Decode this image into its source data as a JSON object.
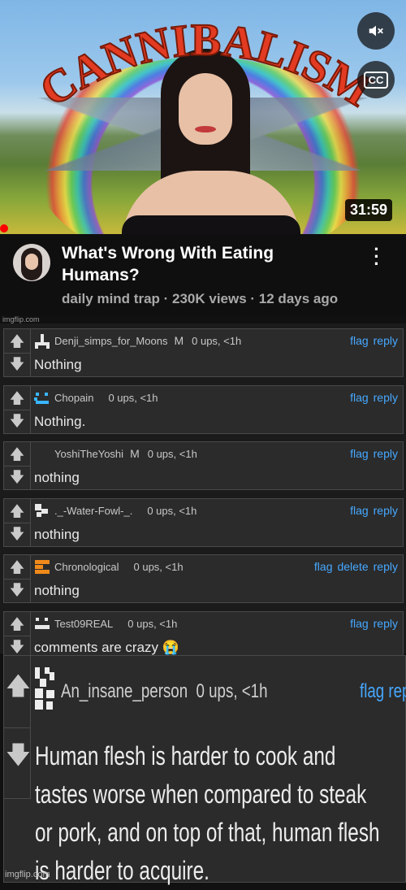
{
  "video": {
    "thumbnail_text": "CANNIBALISM",
    "duration": "31:59",
    "mute_icon": "mute-icon",
    "cc_label": "CC"
  },
  "info": {
    "title": "What's Wrong With Eating Humans?",
    "meta": "daily mind trap · 230K views · 12 days ago",
    "watermark": "imgflip.com"
  },
  "comments": [
    {
      "user": "Denji_simps_for_Moons",
      "mod": "M",
      "meta": "0 ups, <1h",
      "actions": [
        "flag",
        "reply"
      ],
      "text": "Nothing",
      "avatar_color": "#e8e8e8"
    },
    {
      "user": "Chopain",
      "mod": "",
      "meta": "0 ups, <1h",
      "actions": [
        "flag",
        "reply"
      ],
      "text": "Nothing.",
      "avatar_color": "#39b6ff"
    },
    {
      "user": "YoshiTheYoshi",
      "mod": "M",
      "meta": "0 ups, <1h",
      "actions": [
        "flag",
        "reply"
      ],
      "text": "nothing",
      "avatar_color": "#2b2b2b"
    },
    {
      "user": "._-Water-Fowl-_.",
      "mod": "",
      "meta": "0 ups, <1h",
      "actions": [
        "flag",
        "reply"
      ],
      "text": "nothing",
      "avatar_color": "#e8e8e8"
    },
    {
      "user": "Chronological",
      "mod": "",
      "meta": "0 ups, <1h",
      "actions": [
        "flag",
        "delete",
        "reply"
      ],
      "text": "nothing",
      "avatar_color": "#f08a1a"
    },
    {
      "user": "Test09REAL",
      "mod": "",
      "meta": "0 ups, <1h",
      "actions": [
        "flag",
        "reply"
      ],
      "text": "comments are crazy 😭",
      "avatar_color": "#e8e8e8"
    }
  ],
  "big_comment": {
    "user": "An_insane_person",
    "meta": "0 ups, <1h",
    "actions": "flag reply",
    "text": "Human flesh is harder to cook and tastes worse when compared to steak or pork, and on top of that, human flesh is harder to acquire.",
    "watermark": "imgflip.com"
  }
}
